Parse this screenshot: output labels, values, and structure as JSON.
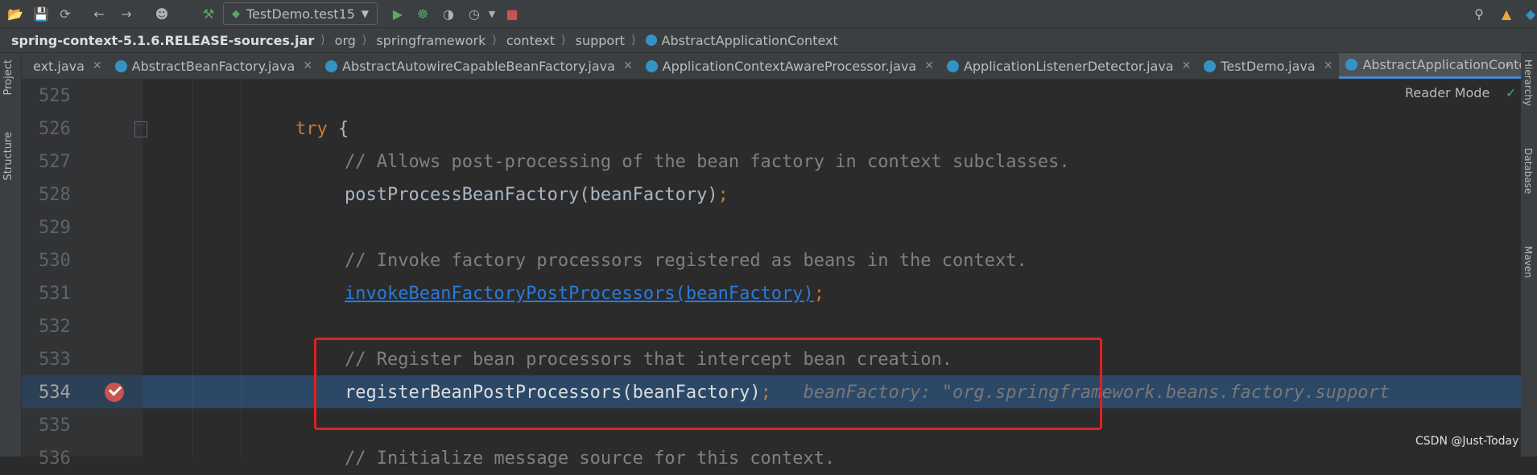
{
  "toolbar": {
    "run_config_label": "TestDemo.test15"
  },
  "breadcrumb": {
    "jar": "spring-context-5.1.6.RELEASE-sources.jar",
    "pkg1": "org",
    "pkg2": "springframework",
    "pkg3": "context",
    "pkg4": "support",
    "cls": "AbstractApplicationContext"
  },
  "side_left": {
    "project": "Project",
    "structure": "Structure"
  },
  "side_right": {
    "hierarchy": "Hierarchy",
    "database": "Database",
    "maven": "Maven"
  },
  "tabs": [
    {
      "label": "ext.java"
    },
    {
      "label": "AbstractBeanFactory.java"
    },
    {
      "label": "AbstractAutowireCapableBeanFactory.java"
    },
    {
      "label": "ApplicationContextAwareProcessor.java"
    },
    {
      "label": "ApplicationListenerDetector.java"
    },
    {
      "label": "TestDemo.java"
    },
    {
      "label": "AbstractApplicationContext.java"
    }
  ],
  "editor": {
    "reader_mode": "Reader Mode",
    "lines": [
      {
        "num": "525",
        "text": ""
      },
      {
        "num": "526",
        "kw": "try",
        "rest": " {"
      },
      {
        "num": "527",
        "comment": "// Allows post-processing of the bean factory in context subclasses."
      },
      {
        "num": "528",
        "code": "postProcessBeanFactory(beanFactory)",
        "semi": ";"
      },
      {
        "num": "529",
        "text": ""
      },
      {
        "num": "530",
        "comment": "// Invoke factory processors registered as beans in the context."
      },
      {
        "num": "531",
        "link": "invokeBeanFactoryPostProcessors(beanFactory)",
        "semi": ";"
      },
      {
        "num": "532",
        "text": ""
      },
      {
        "num": "533",
        "comment": "// Register bean processors that intercept bean creation."
      },
      {
        "num": "534",
        "code": "registerBeanPostProcessors(beanFactory)",
        "semi": ";",
        "hint": "beanFactory: \"org.springframework.beans.factory.support"
      },
      {
        "num": "535",
        "text": ""
      },
      {
        "num": "536",
        "comment": "// Initialize message source for this context."
      }
    ]
  },
  "watermark": "CSDN @Just-Today",
  "colors": {
    "keyword": "#cc7832",
    "comment": "#808080",
    "link": "#287bde",
    "exec_line": "#2d6099",
    "highlight_box": "#e02020"
  }
}
